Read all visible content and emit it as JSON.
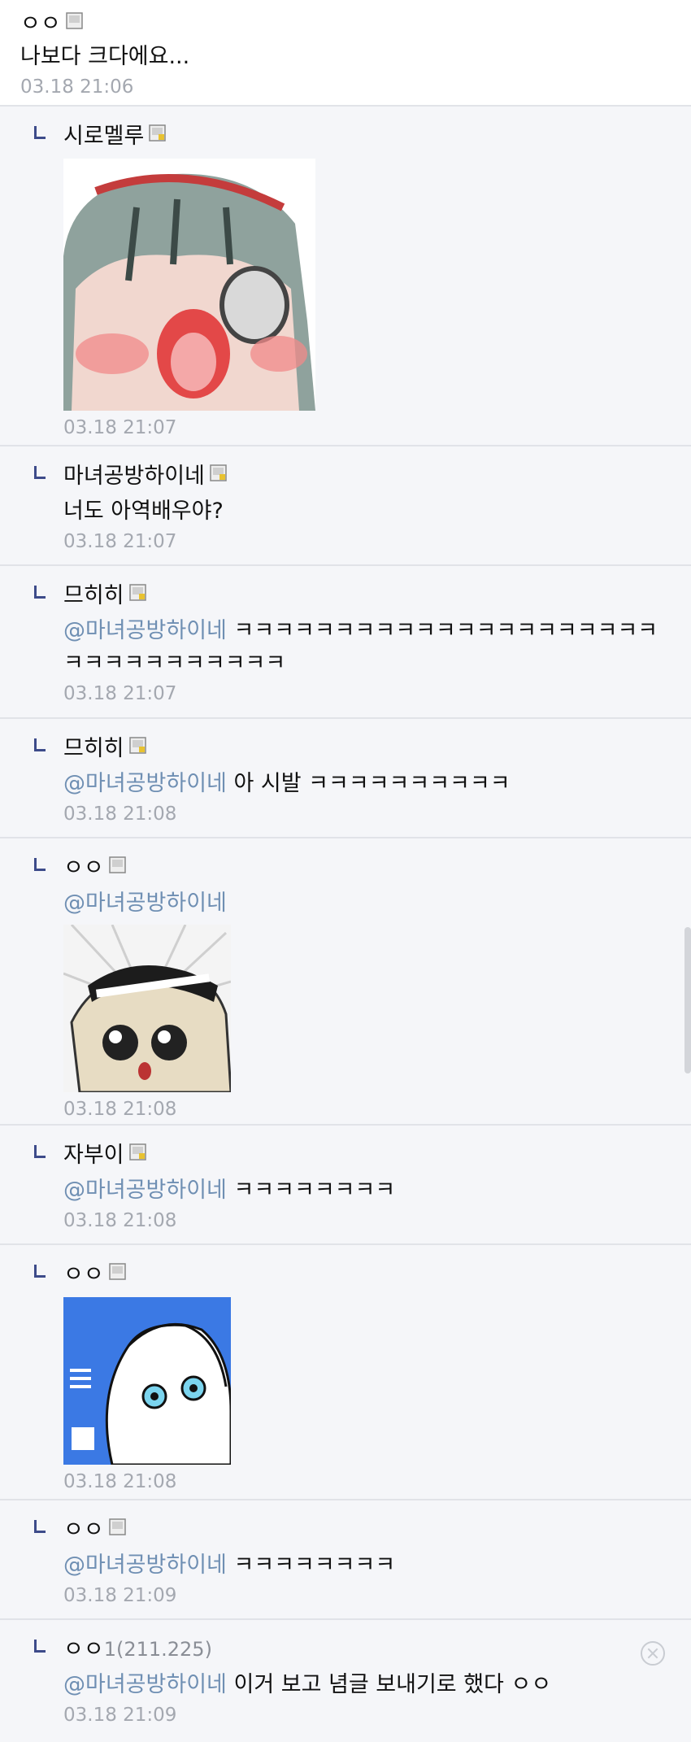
{
  "top_comment": {
    "nickname": "ㅇㅇ",
    "text": "나보다 크다에요...",
    "time": "03.18 21:06"
  },
  "replies": [
    {
      "nickname": "시로멜루",
      "time": "03.18 21:07",
      "sticker": "crying-girl-sticker"
    },
    {
      "nickname": "마녀공방하이네",
      "text": "너도 아역배우야?",
      "time": "03.18 21:07"
    },
    {
      "nickname": "므히히",
      "mention": "@마녀공방하이네",
      "text": "ㅋㅋㅋㅋㅋㅋㅋㅋㅋㅋㅋㅋㅋㅋㅋㅋㅋㅋㅋㅋㅋㅋㅋㅋㅋㅋㅋㅋㅋㅋㅋㅋ",
      "time": "03.18 21:07"
    },
    {
      "nickname": "므히히",
      "mention": "@마녀공방하이네",
      "text": "아 시발 ㅋㅋㅋㅋㅋㅋㅋㅋㅋㅋ",
      "time": "03.18 21:08"
    },
    {
      "nickname": "ㅇㅇ",
      "mention": "@마녀공방하이네",
      "time": "03.18 21:08",
      "sticker": "shocked-girl-sticker"
    },
    {
      "nickname": "자부이",
      "mention": "@마녀공방하이네",
      "text": "ㅋㅋㅋㅋㅋㅋㅋㅋ",
      "time": "03.18 21:08"
    },
    {
      "nickname": "ㅇㅇ",
      "time": "03.18 21:08",
      "sticker": "bluescreen-girl-sticker"
    },
    {
      "nickname": "ㅇㅇ",
      "mention": "@마녀공방하이네",
      "text": "ㅋㅋㅋㅋㅋㅋㅋㅋ",
      "time": "03.18 21:09"
    },
    {
      "nickname": "ㅇㅇ",
      "ip": "1(211.225)",
      "mention": "@마녀공방하이네",
      "text": "이거 보고 념글 보내기로 했다 ㅇㅇ",
      "time": "03.18 21:09"
    }
  ],
  "colors": {
    "mention": "#6f8fb3",
    "time": "#a4a8b0",
    "reply_background": "#f5f6f9",
    "reply_arrow": "#3d4b8a"
  }
}
